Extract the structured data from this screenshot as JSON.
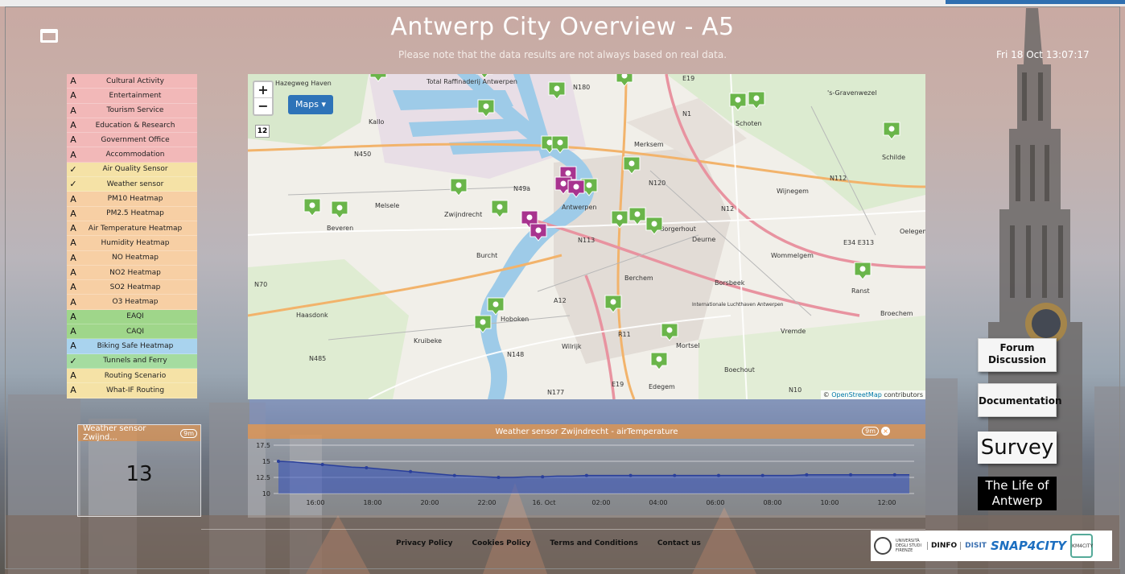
{
  "header": {
    "title": "Antwerp City Overview - A5",
    "subtitle": "Please note that the data results are not always based on real data.",
    "clock": "Fri 18 Oct 13:07:17"
  },
  "menu": {
    "items": [
      {
        "label": "Cultural Activity",
        "color": "#f2b8b8",
        "icon": "A"
      },
      {
        "label": "Entertainment",
        "color": "#f2b8b8",
        "icon": "A"
      },
      {
        "label": "Tourism Service",
        "color": "#f2b8b8",
        "icon": "A"
      },
      {
        "label": "Education & Research",
        "color": "#f2b8b8",
        "icon": "A"
      },
      {
        "label": "Government Office",
        "color": "#f2b8b8",
        "icon": "A"
      },
      {
        "label": "Accommodation",
        "color": "#f2b8b8",
        "icon": "A"
      },
      {
        "label": "Air Quality Sensor",
        "color": "#f5e2a6",
        "icon": "✓"
      },
      {
        "label": "Weather sensor",
        "color": "#f5e2a6",
        "icon": "✓"
      },
      {
        "label": "PM10 Heatmap",
        "color": "#f7cfa4",
        "icon": "A"
      },
      {
        "label": "PM2.5 Heatmap",
        "color": "#f7cfa4",
        "icon": "A"
      },
      {
        "label": "Air Temperature Heatmap",
        "color": "#f7cfa4",
        "icon": "A"
      },
      {
        "label": "Humidity Heatmap",
        "color": "#f7cfa4",
        "icon": "A"
      },
      {
        "label": "NO Heatmap",
        "color": "#f7cfa4",
        "icon": "A"
      },
      {
        "label": "NO2 Heatmap",
        "color": "#f7cfa4",
        "icon": "A"
      },
      {
        "label": "SO2 Heatmap",
        "color": "#f7cfa4",
        "icon": "A"
      },
      {
        "label": "O3 Heatmap",
        "color": "#f7cfa4",
        "icon": "A"
      },
      {
        "label": "EAQI",
        "color": "#9fd68a",
        "icon": "A"
      },
      {
        "label": "CAQI",
        "color": "#9fd68a",
        "icon": "A"
      },
      {
        "label": "Biking Safe Heatmap",
        "color": "#a9d3ee",
        "icon": "A"
      },
      {
        "label": "Tunnels and Ferry",
        "color": "#a5dca0",
        "icon": "✓"
      },
      {
        "label": "Routing Scenario",
        "color": "#f5e2a6",
        "icon": "A"
      },
      {
        "label": "What-IF Routing",
        "color": "#f5e2a6",
        "icon": "A"
      }
    ]
  },
  "map": {
    "zoom_in": "+",
    "zoom_out": "−",
    "zoom_level": "12",
    "maps_button": "Maps ▾",
    "attribution_prefix": "© ",
    "attribution_link": "OpenStreetMap",
    "attribution_suffix": " contributors",
    "place_labels": [
      "Hazegweg Haven",
      "Total Raffinaderij Antwerpen",
      "Kallo",
      "N180",
      "E19",
      "N1",
      "'s-Gravenwezel",
      "Schoten",
      "Schilde",
      "Merksem",
      "N450",
      "N49a",
      "Antwerpen",
      "N120",
      "Wijnegem",
      "N112",
      "Melsele",
      "Zwijndrecht",
      "Beveren",
      "N12",
      "Oelegem",
      "Deurne",
      "N113",
      "Burcht",
      "E34 E313",
      "Wommelgem",
      "N70",
      "Berchem",
      "Borsbeek",
      "Ranst",
      "A12",
      "Haasdonk",
      "Hoboken",
      "Internationale Luchthaven Antwerpen",
      "Broechem",
      "Vremde",
      "Kruibeke",
      "R11",
      "N148",
      "Wilrijk",
      "Mortsel",
      "N485",
      "Boechout",
      "E19",
      "N177",
      "Edegem",
      "N10",
      "Borgerhout"
    ]
  },
  "widget_value": {
    "title": "Weather sensor Zwijnd...",
    "badge": "9m",
    "value": "13"
  },
  "widget_chart": {
    "title": "Weather sensor Zwijndrecht - airTemperature",
    "badge": "9m"
  },
  "chart_data": {
    "type": "area",
    "title": "Weather sensor Zwijndrecht - airTemperature",
    "x": [
      "15:10",
      "15:40",
      "16:10",
      "16:40",
      "17:10",
      "17:40",
      "18:10",
      "18:40",
      "19:10",
      "19:40",
      "20:10",
      "20:40",
      "21:10",
      "21:40",
      "22:10",
      "22:40",
      "23:10",
      "23:40",
      "00:10",
      "00:40",
      "01:10",
      "01:40",
      "02:10",
      "02:40",
      "03:10",
      "03:40",
      "04:10",
      "04:40",
      "05:10",
      "05:40",
      "06:10",
      "06:40",
      "07:10",
      "07:40",
      "08:10",
      "08:40",
      "09:10",
      "09:40",
      "10:10",
      "10:40",
      "11:10",
      "11:40",
      "12:10",
      "12:40"
    ],
    "values": [
      15.0,
      14.9,
      14.7,
      14.5,
      14.3,
      14.1,
      14.0,
      13.8,
      13.6,
      13.4,
      13.2,
      13.0,
      12.8,
      12.7,
      12.6,
      12.5,
      12.5,
      12.6,
      12.6,
      12.7,
      12.7,
      12.8,
      12.8,
      12.8,
      12.8,
      12.8,
      12.8,
      12.8,
      12.8,
      12.8,
      12.8,
      12.8,
      12.8,
      12.8,
      12.8,
      12.8,
      12.9,
      12.9,
      12.9,
      12.9,
      12.9,
      12.9,
      12.9,
      12.9
    ],
    "xticks": [
      "16:00",
      "18:00",
      "20:00",
      "22:00",
      "16. Oct",
      "02:00",
      "04:00",
      "06:00",
      "08:00",
      "10:00",
      "12:00"
    ],
    "yticks": [
      "17.5",
      "15",
      "12.5",
      "10"
    ],
    "ylim": [
      10,
      17.5
    ],
    "grid": true
  },
  "side_buttons": {
    "forum": "Forum Discussion",
    "documentation": "Documentation",
    "survey": "Survey",
    "life": "The Life of Antwerp"
  },
  "footer": {
    "links": [
      "Privacy Policy",
      "Cookies Policy",
      "Terms and Conditions",
      "Contact us"
    ]
  },
  "logos": {
    "unifi": "UNIVERSITÀ DEGLI STUDI FIRENZE",
    "dinfo": "DINFO",
    "disit": "DISIT",
    "snap4city": "SNAP4CITY",
    "km4city": "KM4CITY"
  },
  "colors": {
    "accent_blue": "#2e73b8",
    "widget_header": "#f08c32",
    "marker_green": "#6ab54a",
    "marker_purple": "#a8338f"
  }
}
